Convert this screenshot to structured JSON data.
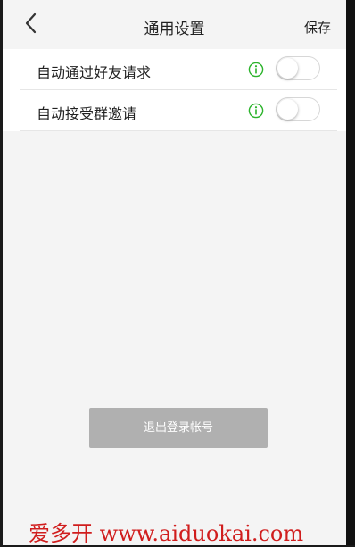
{
  "header": {
    "title": "通用设置",
    "save_label": "保存",
    "back_icon": "chevron-left-icon"
  },
  "settings": [
    {
      "label": "自动通过好友请求",
      "enabled": false,
      "info_icon": "info-icon"
    },
    {
      "label": "自动接受群邀请",
      "enabled": false,
      "info_icon": "info-icon"
    }
  ],
  "logout": {
    "label": "退出登录帐号"
  },
  "watermark": {
    "text": "爱多开 www.aiduokai.com"
  },
  "colors": {
    "info_icon": "#2bb32b",
    "logout_bg": "#b0b0b0",
    "watermark": "#d01d1d"
  }
}
